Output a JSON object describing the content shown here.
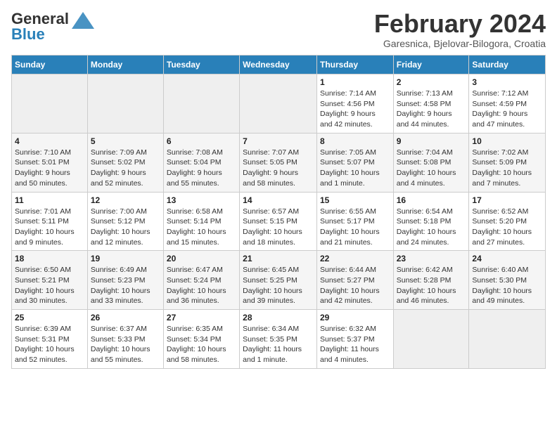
{
  "header": {
    "logo_general": "General",
    "logo_blue": "Blue",
    "month_year": "February 2024",
    "location": "Garesnica, Bjelovar-Bilogora, Croatia"
  },
  "days_of_week": [
    "Sunday",
    "Monday",
    "Tuesday",
    "Wednesday",
    "Thursday",
    "Friday",
    "Saturday"
  ],
  "weeks": [
    [
      {
        "day": "",
        "info": ""
      },
      {
        "day": "",
        "info": ""
      },
      {
        "day": "",
        "info": ""
      },
      {
        "day": "",
        "info": ""
      },
      {
        "day": "1",
        "info": "Sunrise: 7:14 AM\nSunset: 4:56 PM\nDaylight: 9 hours\nand 42 minutes."
      },
      {
        "day": "2",
        "info": "Sunrise: 7:13 AM\nSunset: 4:58 PM\nDaylight: 9 hours\nand 44 minutes."
      },
      {
        "day": "3",
        "info": "Sunrise: 7:12 AM\nSunset: 4:59 PM\nDaylight: 9 hours\nand 47 minutes."
      }
    ],
    [
      {
        "day": "4",
        "info": "Sunrise: 7:10 AM\nSunset: 5:01 PM\nDaylight: 9 hours\nand 50 minutes."
      },
      {
        "day": "5",
        "info": "Sunrise: 7:09 AM\nSunset: 5:02 PM\nDaylight: 9 hours\nand 52 minutes."
      },
      {
        "day": "6",
        "info": "Sunrise: 7:08 AM\nSunset: 5:04 PM\nDaylight: 9 hours\nand 55 minutes."
      },
      {
        "day": "7",
        "info": "Sunrise: 7:07 AM\nSunset: 5:05 PM\nDaylight: 9 hours\nand 58 minutes."
      },
      {
        "day": "8",
        "info": "Sunrise: 7:05 AM\nSunset: 5:07 PM\nDaylight: 10 hours\nand 1 minute."
      },
      {
        "day": "9",
        "info": "Sunrise: 7:04 AM\nSunset: 5:08 PM\nDaylight: 10 hours\nand 4 minutes."
      },
      {
        "day": "10",
        "info": "Sunrise: 7:02 AM\nSunset: 5:09 PM\nDaylight: 10 hours\nand 7 minutes."
      }
    ],
    [
      {
        "day": "11",
        "info": "Sunrise: 7:01 AM\nSunset: 5:11 PM\nDaylight: 10 hours\nand 9 minutes."
      },
      {
        "day": "12",
        "info": "Sunrise: 7:00 AM\nSunset: 5:12 PM\nDaylight: 10 hours\nand 12 minutes."
      },
      {
        "day": "13",
        "info": "Sunrise: 6:58 AM\nSunset: 5:14 PM\nDaylight: 10 hours\nand 15 minutes."
      },
      {
        "day": "14",
        "info": "Sunrise: 6:57 AM\nSunset: 5:15 PM\nDaylight: 10 hours\nand 18 minutes."
      },
      {
        "day": "15",
        "info": "Sunrise: 6:55 AM\nSunset: 5:17 PM\nDaylight: 10 hours\nand 21 minutes."
      },
      {
        "day": "16",
        "info": "Sunrise: 6:54 AM\nSunset: 5:18 PM\nDaylight: 10 hours\nand 24 minutes."
      },
      {
        "day": "17",
        "info": "Sunrise: 6:52 AM\nSunset: 5:20 PM\nDaylight: 10 hours\nand 27 minutes."
      }
    ],
    [
      {
        "day": "18",
        "info": "Sunrise: 6:50 AM\nSunset: 5:21 PM\nDaylight: 10 hours\nand 30 minutes."
      },
      {
        "day": "19",
        "info": "Sunrise: 6:49 AM\nSunset: 5:23 PM\nDaylight: 10 hours\nand 33 minutes."
      },
      {
        "day": "20",
        "info": "Sunrise: 6:47 AM\nSunset: 5:24 PM\nDaylight: 10 hours\nand 36 minutes."
      },
      {
        "day": "21",
        "info": "Sunrise: 6:45 AM\nSunset: 5:25 PM\nDaylight: 10 hours\nand 39 minutes."
      },
      {
        "day": "22",
        "info": "Sunrise: 6:44 AM\nSunset: 5:27 PM\nDaylight: 10 hours\nand 42 minutes."
      },
      {
        "day": "23",
        "info": "Sunrise: 6:42 AM\nSunset: 5:28 PM\nDaylight: 10 hours\nand 46 minutes."
      },
      {
        "day": "24",
        "info": "Sunrise: 6:40 AM\nSunset: 5:30 PM\nDaylight: 10 hours\nand 49 minutes."
      }
    ],
    [
      {
        "day": "25",
        "info": "Sunrise: 6:39 AM\nSunset: 5:31 PM\nDaylight: 10 hours\nand 52 minutes."
      },
      {
        "day": "26",
        "info": "Sunrise: 6:37 AM\nSunset: 5:33 PM\nDaylight: 10 hours\nand 55 minutes."
      },
      {
        "day": "27",
        "info": "Sunrise: 6:35 AM\nSunset: 5:34 PM\nDaylight: 10 hours\nand 58 minutes."
      },
      {
        "day": "28",
        "info": "Sunrise: 6:34 AM\nSunset: 5:35 PM\nDaylight: 11 hours\nand 1 minute."
      },
      {
        "day": "29",
        "info": "Sunrise: 6:32 AM\nSunset: 5:37 PM\nDaylight: 11 hours\nand 4 minutes."
      },
      {
        "day": "",
        "info": ""
      },
      {
        "day": "",
        "info": ""
      }
    ]
  ]
}
